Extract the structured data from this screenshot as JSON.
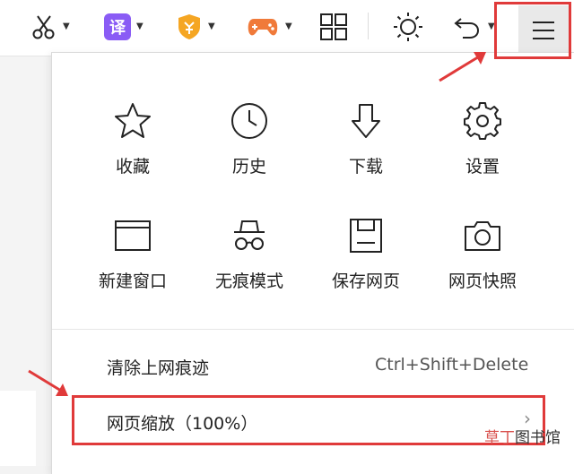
{
  "toolbar": {
    "translate_label": "译",
    "icons": [
      "scissors-icon",
      "translate-icon",
      "shield-icon",
      "gamepad-icon",
      "grid-apps-icon",
      "brightness-icon",
      "undo-icon",
      "menu-icon"
    ]
  },
  "menu": {
    "grid": [
      {
        "icon": "star-icon",
        "label": "收藏"
      },
      {
        "icon": "clock-icon",
        "label": "历史"
      },
      {
        "icon": "download-icon",
        "label": "下载"
      },
      {
        "icon": "gear-icon",
        "label": "设置"
      },
      {
        "icon": "window-icon",
        "label": "新建窗口"
      },
      {
        "icon": "incognito-icon",
        "label": "无痕模式"
      },
      {
        "icon": "save-icon",
        "label": "保存网页"
      },
      {
        "icon": "camera-icon",
        "label": "网页快照"
      }
    ],
    "clear": {
      "label": "清除上网痕迹",
      "shortcut": "Ctrl+Shift+Delete"
    },
    "zoom": {
      "label": "网页缩放（100%）",
      "chevron": "›"
    }
  },
  "watermark": {
    "part1": "草丁",
    "part2": "图书馆"
  },
  "colors": {
    "highlight": "#e03a3a",
    "accent": "#8a5cf5",
    "shield": "#f5a623",
    "gamepad": "#f07a3a"
  }
}
